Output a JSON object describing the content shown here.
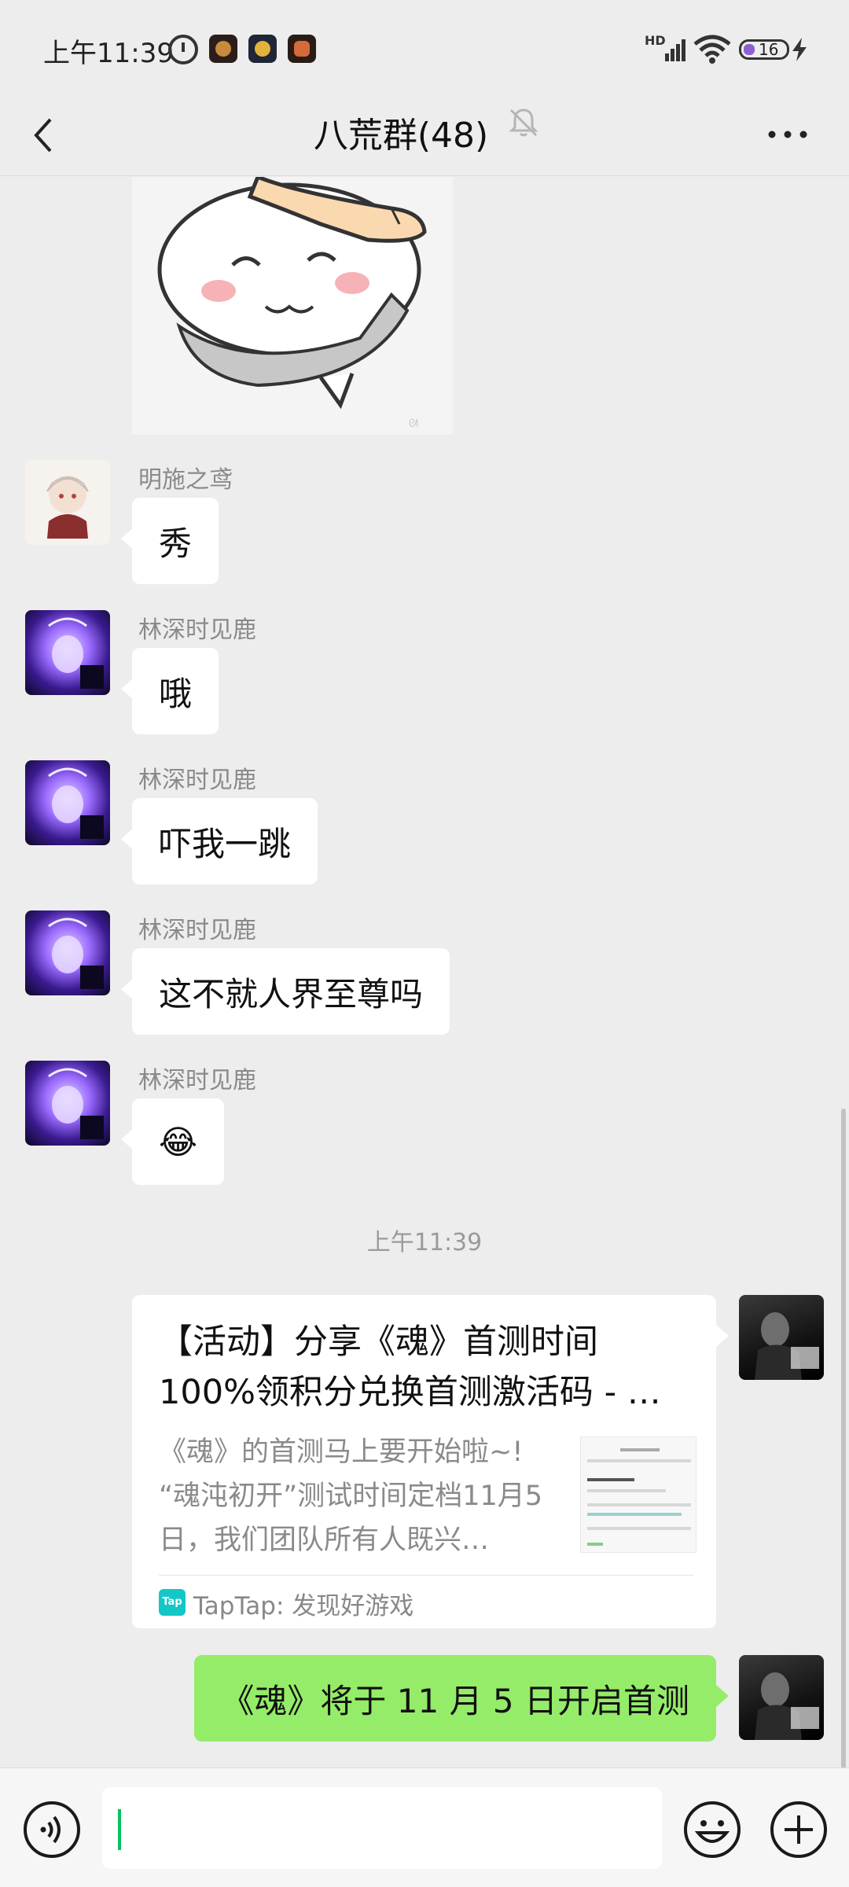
{
  "status_bar": {
    "time": "上午11:39",
    "network_label": "HD",
    "battery": "16"
  },
  "header": {
    "title": "八荒群(48)"
  },
  "messages": [
    {
      "sender": "明施之鸢",
      "text": "秀"
    },
    {
      "sender": "林深时见鹿",
      "text": "哦"
    },
    {
      "sender": "林深时见鹿",
      "text": "吓我一跳"
    },
    {
      "sender": "林深时见鹿",
      "text": "这不就人界至尊吗"
    },
    {
      "sender": "林深时见鹿",
      "text": "😂"
    }
  ],
  "time_divider": "上午11:39",
  "link_card": {
    "title": "【活动】分享《魂》首测时间100%领积分兑换首测激活码 - …",
    "description": "《魂》的首测马上要开始啦~! “魂沌初开”测试时间定档11月5日，我们团队所有人既兴…",
    "source": "TapTap: 发现好游戏",
    "source_icon_text": "Tap"
  },
  "my_message": "《魂》将于 11 月 5 日开启首测",
  "colors": {
    "my_bubble": "#95ec69",
    "background": "#ededed",
    "cursor": "#07c160"
  }
}
